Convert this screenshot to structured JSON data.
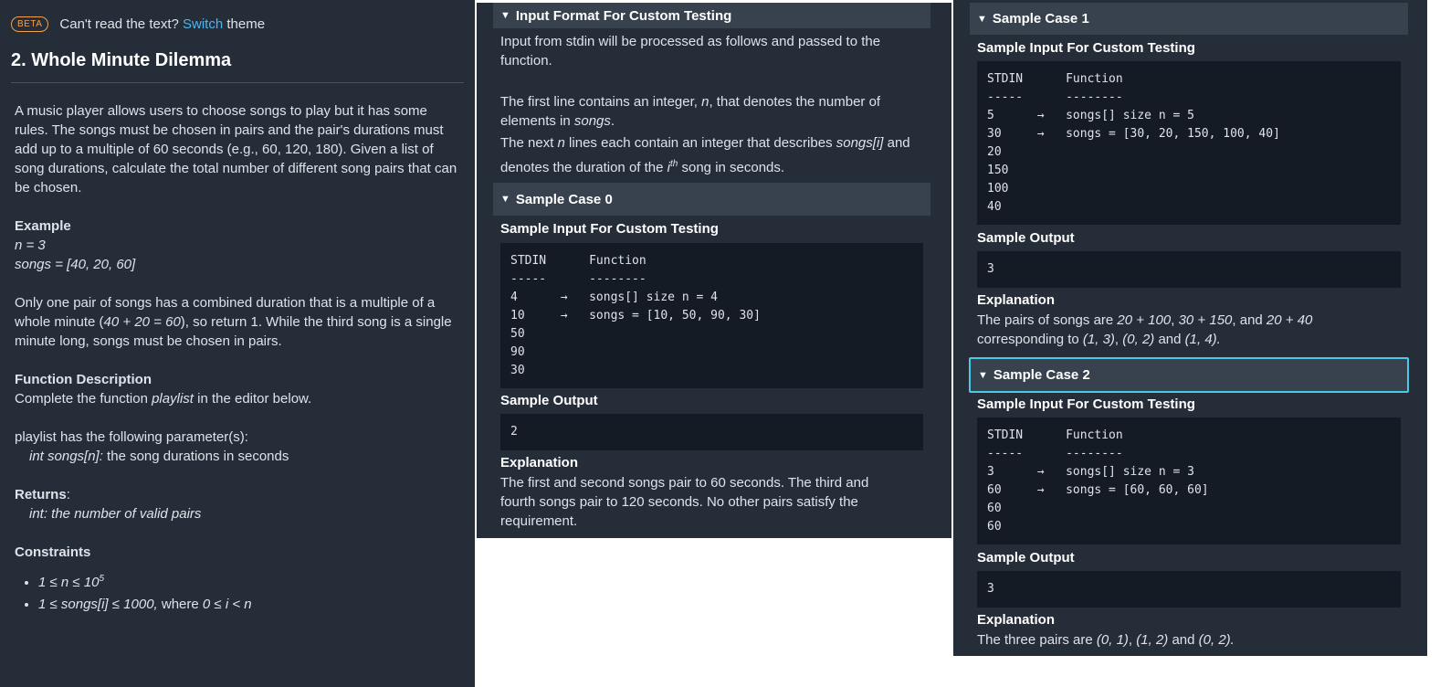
{
  "left_panel": {
    "badge": "BETA",
    "theme_prefix": "Can't read the text?",
    "theme_link": "Switch",
    "theme_suffix": "theme",
    "title": "2. Whole Minute Dilemma",
    "intro": "A music player allows users to choose songs to play but it has some rules. The songs must be chosen in pairs and the pair's durations must add up to a multiple of 60 seconds (e.g., 60, 120, 180). Given a list of song durations, calculate the total number of different song pairs that can be chosen.",
    "example_heading": "Example",
    "example_n": "n = 3",
    "example_songs": "songs = [40, 20, 60]",
    "example_text_a": "Only one pair of songs has a combined duration that is a multiple of a whole minute (",
    "example_text_expr": "40 + 20 = 60",
    "example_text_b": "), so return 1. While the third song is a single minute long, songs must be chosen in pairs.",
    "func_heading": "Function Description",
    "func_text_a": "Complete the function ",
    "func_name": "playlist",
    "func_text_b": " in the editor below.",
    "params_heading": "playlist has the following parameter(s):",
    "param_name": "int songs[n]:",
    "param_desc": "  the song durations in seconds",
    "returns_heading": "Returns",
    "returns_text": "int: the number of valid pairs",
    "constraints_heading": "Constraints",
    "constraint1": "1 ≤ n ≤ 10",
    "constraint1_sup": "5",
    "constraint2": "1 ≤ songs[i] ≤ 1000,",
    "constraint2_b": " where ",
    "constraint2_c": "0 ≤ i < n"
  },
  "middle_panel": {
    "input_format_header": "Input Format For Custom Testing",
    "if_line1": "Input from stdin will be processed as follows and passed to the function.",
    "if_line2_a": "The first line contains an integer, ",
    "if_line2_n": "n",
    "if_line2_b": ", that denotes the number of elements in ",
    "if_line2_songs": "songs",
    "if_line2_c": ".",
    "if_line3_a": "The next ",
    "if_line3_n": "n",
    "if_line3_b": " lines each contain an integer that describes ",
    "if_line3_songs": "songs[i]",
    "if_line3_c": " and denotes the duration of the ",
    "if_line3_i": "i",
    "if_line3_th": "th",
    "if_line3_d": " song in seconds.",
    "case0_header": "Sample Case 0",
    "sample_input_heading": "Sample Input For Custom Testing",
    "case0_input": "STDIN      Function\n-----      --------\n4      →   songs[] size n = 4\n10     →   songs = [10, 50, 90, 30]\n50\n90\n30",
    "sample_output_heading": "Sample Output",
    "case0_output": "2",
    "explanation_heading": "Explanation",
    "case0_explanation": "The first and second songs pair to 60 seconds.  The third and fourth songs pair to 120 seconds.  No other pairs satisfy the requirement."
  },
  "right_panel": {
    "case1_header": "Sample Case 1",
    "sample_input_heading": "Sample Input For Custom Testing",
    "case1_input": "STDIN      Function\n-----      --------\n5      →   songs[] size n = 5\n30     →   songs = [30, 20, 150, 100, 40]\n20\n150\n100\n40",
    "sample_output_heading": "Sample Output",
    "case1_output": "3",
    "explanation_heading": "Explanation",
    "case1_expl_a": "The pairs of songs are ",
    "case1_expl_p1": "20 + 100",
    "case1_expl_b": ", ",
    "case1_expl_p2": "30 + 150",
    "case1_expl_c": ", and ",
    "case1_expl_p3": "20 + 40",
    "case1_expl_d": " corresponding to ",
    "case1_expl_t1": "(1, 3)",
    "case1_expl_e": ", ",
    "case1_expl_t2": "(0, 2)",
    "case1_expl_f": " and ",
    "case1_expl_t3": "(1, 4).",
    "case2_header": "Sample Case 2",
    "case2_input": "STDIN      Function\n-----      --------\n3      →   songs[] size n = 3\n60     →   songs = [60, 60, 60]\n60\n60",
    "case2_output": "3",
    "case2_expl_a": "The three pairs are ",
    "case2_expl_t1": "(0, 1)",
    "case2_expl_b": ", ",
    "case2_expl_t2": "(1, 2)",
    "case2_expl_c": " and ",
    "case2_expl_t3": "(0, 2)."
  },
  "colors": {
    "panel_bg": "#252d39",
    "accordion_bg": "#38424f",
    "code_bg": "#141b25",
    "link": "#4cb6ef",
    "beta": "#f5a04a",
    "focus_outline": "#4cc9e6"
  }
}
